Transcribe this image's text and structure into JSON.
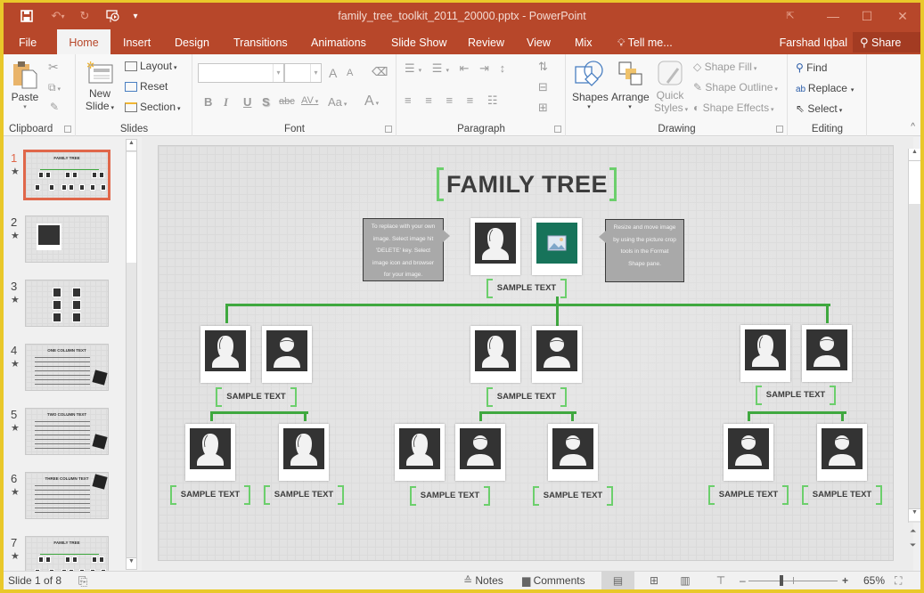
{
  "window": {
    "title": "family_tree_toolkit_2011_20000.pptx - PowerPoint",
    "controls": {
      "ribbon_display": "⇱",
      "minimize": "—",
      "maximize": "☐",
      "close": "✕"
    }
  },
  "quick_access": {
    "save": "save-icon",
    "undo": "undo-icon",
    "redo": "redo-icon",
    "present": "start-from-beginning-icon",
    "customize": "customize-qat-icon"
  },
  "tabs": [
    {
      "label": "File",
      "active": false
    },
    {
      "label": "Home",
      "active": true
    },
    {
      "label": "Insert",
      "active": false
    },
    {
      "label": "Design",
      "active": false
    },
    {
      "label": "Transitions",
      "active": false
    },
    {
      "label": "Animations",
      "active": false
    },
    {
      "label": "Slide Show",
      "active": false
    },
    {
      "label": "Review",
      "active": false
    },
    {
      "label": "View",
      "active": false
    },
    {
      "label": "Mix",
      "active": false
    }
  ],
  "tell_me": "Tell me...",
  "user": "Farshad Iqbal",
  "share": "Share",
  "ribbon": {
    "clipboard": {
      "label": "Clipboard",
      "paste": "Paste"
    },
    "slides": {
      "label": "Slides",
      "new_slide_1": "New",
      "new_slide_2": "Slide",
      "layout": "Layout",
      "reset": "Reset",
      "section": "Section"
    },
    "font": {
      "label": "Font",
      "font_name": "",
      "font_size": "",
      "bold": "B",
      "italic": "I",
      "underline": "U",
      "shadow": "S",
      "strike": "abc",
      "spacing": "AV",
      "case": "Aa",
      "color": "A",
      "grow": "A",
      "shrink": "A"
    },
    "paragraph": {
      "label": "Paragraph"
    },
    "drawing": {
      "label": "Drawing",
      "shapes": "Shapes",
      "arrange": "Arrange",
      "quick_styles_1": "Quick",
      "quick_styles_2": "Styles",
      "shape_fill": "Shape Fill",
      "shape_outline": "Shape Outline",
      "shape_effects": "Shape Effects"
    },
    "editing": {
      "label": "Editing",
      "find": "Find",
      "replace": "Replace",
      "select": "Select"
    }
  },
  "slides_panel": {
    "selected": 1,
    "thumbnails": [
      {
        "number": "1",
        "title": "FAMILY TREE"
      },
      {
        "number": "2",
        "title": ""
      },
      {
        "number": "3",
        "title": ""
      },
      {
        "number": "4",
        "title": "ONE COLUMN TEXT"
      },
      {
        "number": "5",
        "title": "TWO COLUMN TEXT"
      },
      {
        "number": "6",
        "title": "THREE COLUMN TEXT"
      },
      {
        "number": "7",
        "title": "FAMILY TREE"
      }
    ]
  },
  "slide": {
    "title": "FAMILY TREE",
    "callout_left": [
      "To replace with your own",
      "image. Select image hit",
      "'DELETE' key. Select",
      "image icon and browser",
      "for your image."
    ],
    "callout_right": [
      "Resize and move image",
      "by using the picture crop",
      "tools in the Format",
      "Shape pane."
    ],
    "label": "SAMPLE TEXT"
  },
  "status": {
    "slide_counter": "Slide 1 of 8",
    "notes": "Notes",
    "comments": "Comments",
    "zoom": "65%",
    "zoom_fraction": 0.36
  },
  "colors": {
    "accent": "#b7472a",
    "bracket_green": "#6ccf6c",
    "connector_green": "#3fa83f",
    "photo_dark": "#333333",
    "photo_teal": "#17735a",
    "selection": "#e0674a"
  }
}
